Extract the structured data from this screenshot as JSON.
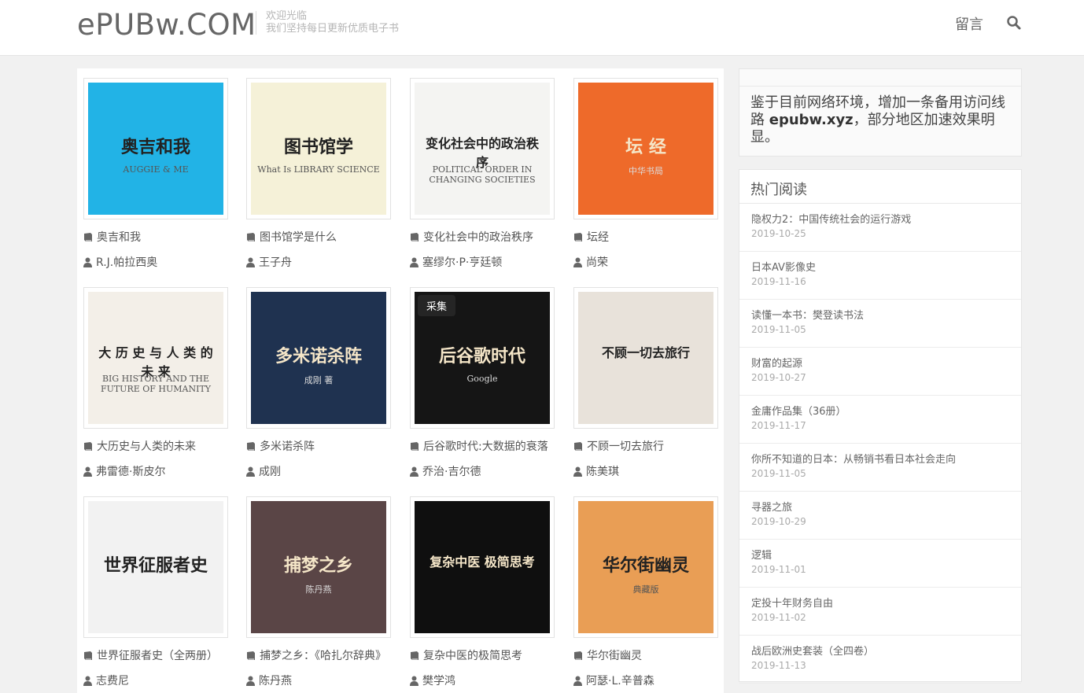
{
  "header": {
    "logo": "ePUBw.COM",
    "tagline_1": "欢迎光临",
    "tagline_2": "我们坚持每日更新优质电子书",
    "nav_message": "留言",
    "search_icon": "search-icon"
  },
  "books": [
    {
      "title": "奥吉和我",
      "author": "R.J.帕拉西奥",
      "cover_color": "#22b3e6",
      "cover_line1": "奥吉和我",
      "cover_line2": "AUGGIE & ME"
    },
    {
      "title": "图书馆学是什么",
      "author": "王子舟",
      "cover_color": "#f5f1d8",
      "cover_line1": "图书馆学",
      "cover_line2": "What Is LIBRARY SCIENCE"
    },
    {
      "title": "变化社会中的政治秩序",
      "author": "塞缪尔·P·亨廷顿",
      "cover_color": "#f4f4f2",
      "cover_line1": "变化社会中的政治秩序",
      "cover_line2": "POLITICAL ORDER IN CHANGING SOCIETIES"
    },
    {
      "title": "坛经",
      "author": "尚荣",
      "cover_color": "#ee6a2a",
      "cover_line1": "坛 经",
      "cover_line2": "中华书局"
    },
    {
      "title": "大历史与人类的未来",
      "author": "弗雷德·斯皮尔",
      "cover_color": "#f3efe8",
      "cover_line1": "大 历 史 与 人 类 的 未 来",
      "cover_line2": "BIG HISTORY AND THE FUTURE OF HUMANITY"
    },
    {
      "title": "多米诺杀阵",
      "author": "成刚",
      "cover_color": "#1f3250",
      "cover_line1": "多米诺杀阵",
      "cover_line2": "成刚 著"
    },
    {
      "title": "后谷歌时代:大数据的衰落",
      "author": "乔治·吉尔德",
      "cover_color": "#151515",
      "cover_line1": "后谷歌时代",
      "cover_line2": "Google",
      "badge": "采集"
    },
    {
      "title": "不顾一切去旅行",
      "author": "陈美琪",
      "cover_color": "#e8e2da",
      "cover_line1": "不顾一切去旅行",
      "cover_line2": ""
    },
    {
      "title": "世界征服者史（全两册）",
      "author": "志费尼",
      "cover_color": "#f2f2f2",
      "cover_line1": "世界征服者史",
      "cover_line2": ""
    },
    {
      "title": "捕梦之乡：《哈扎尔辞典》",
      "author": "陈丹燕",
      "cover_color": "#5a4546",
      "cover_line1": "捕梦之乡",
      "cover_line2": "陈丹燕"
    },
    {
      "title": "复杂中医的极简思考",
      "author": "樊学鸿",
      "cover_color": "#0f0f0f",
      "cover_line1": "复杂中医 极简思考",
      "cover_line2": ""
    },
    {
      "title": "华尔街幽灵",
      "author": "阿瑟·L.辛普森",
      "cover_color": "#e99e55",
      "cover_line1": "华尔街幽灵",
      "cover_line2": "典藏版"
    }
  ],
  "notice": {
    "text_before": "鉴于目前网络环境，增加一条备用访问线路 ",
    "domain": "epubw.xyz",
    "text_after": "，部分地区加速效果明显。"
  },
  "hot": {
    "title": "热门阅读",
    "items": [
      {
        "title": "隐权力2：中国传统社会的运行游戏",
        "date": "2019-10-25"
      },
      {
        "title": "日本AV影像史",
        "date": "2019-11-16"
      },
      {
        "title": "读懂一本书：樊登读书法",
        "date": "2019-11-05"
      },
      {
        "title": "财富的起源",
        "date": "2019-10-27"
      },
      {
        "title": "金庸作品集（36册）",
        "date": "2019-11-17"
      },
      {
        "title": "你所不知道的日本：从畅销书看日本社会走向",
        "date": "2019-11-05"
      },
      {
        "title": "寻器之旅",
        "date": "2019-10-29"
      },
      {
        "title": "逻辑",
        "date": "2019-11-01"
      },
      {
        "title": "定投十年财务自由",
        "date": "2019-11-02"
      },
      {
        "title": "战后欧洲史套装（全四卷）",
        "date": "2019-11-13"
      }
    ]
  }
}
